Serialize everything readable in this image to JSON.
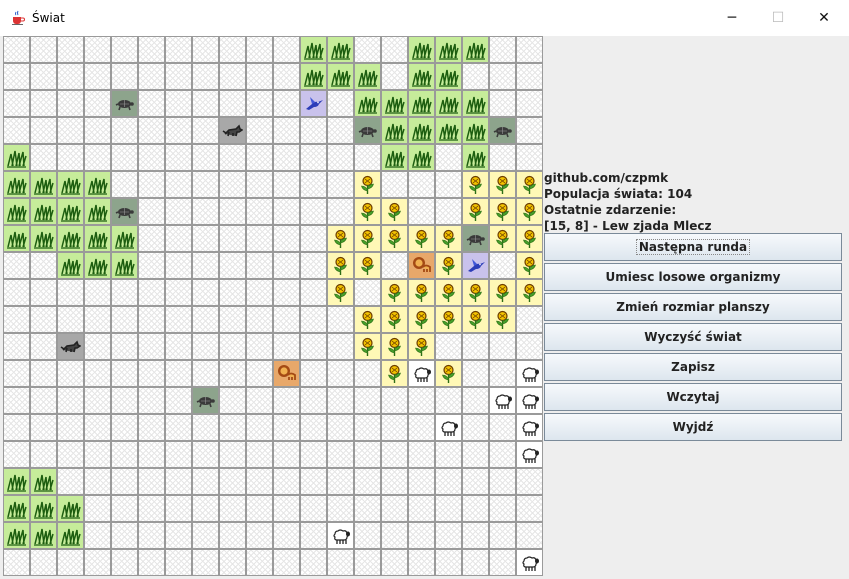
{
  "window": {
    "title": "Świat",
    "app_icon": "java-cup-icon",
    "controls": {
      "minimize": "─",
      "maximize": "☐",
      "close": "✕"
    }
  },
  "board": {
    "cols": 20,
    "rows": 20,
    "organisms": [
      {
        "x": 11,
        "y": 0,
        "type": "grass"
      },
      {
        "x": 12,
        "y": 0,
        "type": "grass"
      },
      {
        "x": 15,
        "y": 0,
        "type": "grass"
      },
      {
        "x": 16,
        "y": 0,
        "type": "grass"
      },
      {
        "x": 17,
        "y": 0,
        "type": "grass"
      },
      {
        "x": 11,
        "y": 1,
        "type": "grass"
      },
      {
        "x": 12,
        "y": 1,
        "type": "grass"
      },
      {
        "x": 13,
        "y": 1,
        "type": "grass"
      },
      {
        "x": 15,
        "y": 1,
        "type": "grass"
      },
      {
        "x": 16,
        "y": 1,
        "type": "grass"
      },
      {
        "x": 4,
        "y": 2,
        "type": "turtle"
      },
      {
        "x": 11,
        "y": 2,
        "type": "hummingbird"
      },
      {
        "x": 13,
        "y": 2,
        "type": "grass"
      },
      {
        "x": 14,
        "y": 2,
        "type": "grass"
      },
      {
        "x": 15,
        "y": 2,
        "type": "grass"
      },
      {
        "x": 16,
        "y": 2,
        "type": "grass"
      },
      {
        "x": 17,
        "y": 2,
        "type": "grass"
      },
      {
        "x": 8,
        "y": 3,
        "type": "wolf"
      },
      {
        "x": 13,
        "y": 3,
        "type": "turtle"
      },
      {
        "x": 14,
        "y": 3,
        "type": "grass"
      },
      {
        "x": 15,
        "y": 3,
        "type": "grass"
      },
      {
        "x": 16,
        "y": 3,
        "type": "grass"
      },
      {
        "x": 17,
        "y": 3,
        "type": "grass"
      },
      {
        "x": 18,
        "y": 3,
        "type": "turtle"
      },
      {
        "x": 0,
        "y": 4,
        "type": "grass"
      },
      {
        "x": 14,
        "y": 4,
        "type": "grass"
      },
      {
        "x": 15,
        "y": 4,
        "type": "grass"
      },
      {
        "x": 17,
        "y": 4,
        "type": "grass"
      },
      {
        "x": 0,
        "y": 5,
        "type": "grass"
      },
      {
        "x": 1,
        "y": 5,
        "type": "grass"
      },
      {
        "x": 2,
        "y": 5,
        "type": "grass"
      },
      {
        "x": 3,
        "y": 5,
        "type": "grass"
      },
      {
        "x": 13,
        "y": 5,
        "type": "dandelion"
      },
      {
        "x": 17,
        "y": 5,
        "type": "dandelion"
      },
      {
        "x": 18,
        "y": 5,
        "type": "dandelion"
      },
      {
        "x": 19,
        "y": 5,
        "type": "dandelion"
      },
      {
        "x": 0,
        "y": 6,
        "type": "grass"
      },
      {
        "x": 1,
        "y": 6,
        "type": "grass"
      },
      {
        "x": 2,
        "y": 6,
        "type": "grass"
      },
      {
        "x": 3,
        "y": 6,
        "type": "grass"
      },
      {
        "x": 4,
        "y": 6,
        "type": "turtle"
      },
      {
        "x": 13,
        "y": 6,
        "type": "dandelion"
      },
      {
        "x": 14,
        "y": 6,
        "type": "dandelion"
      },
      {
        "x": 17,
        "y": 6,
        "type": "dandelion"
      },
      {
        "x": 18,
        "y": 6,
        "type": "dandelion"
      },
      {
        "x": 19,
        "y": 6,
        "type": "dandelion"
      },
      {
        "x": 0,
        "y": 7,
        "type": "grass"
      },
      {
        "x": 1,
        "y": 7,
        "type": "grass"
      },
      {
        "x": 2,
        "y": 7,
        "type": "grass"
      },
      {
        "x": 3,
        "y": 7,
        "type": "grass"
      },
      {
        "x": 4,
        "y": 7,
        "type": "grass"
      },
      {
        "x": 12,
        "y": 7,
        "type": "dandelion"
      },
      {
        "x": 13,
        "y": 7,
        "type": "dandelion"
      },
      {
        "x": 14,
        "y": 7,
        "type": "dandelion"
      },
      {
        "x": 15,
        "y": 7,
        "type": "dandelion"
      },
      {
        "x": 16,
        "y": 7,
        "type": "dandelion"
      },
      {
        "x": 17,
        "y": 7,
        "type": "turtle"
      },
      {
        "x": 18,
        "y": 7,
        "type": "dandelion"
      },
      {
        "x": 19,
        "y": 7,
        "type": "dandelion"
      },
      {
        "x": 2,
        "y": 8,
        "type": "grass"
      },
      {
        "x": 3,
        "y": 8,
        "type": "grass"
      },
      {
        "x": 4,
        "y": 8,
        "type": "grass"
      },
      {
        "x": 12,
        "y": 8,
        "type": "dandelion"
      },
      {
        "x": 13,
        "y": 8,
        "type": "dandelion"
      },
      {
        "x": 15,
        "y": 8,
        "type": "lion"
      },
      {
        "x": 16,
        "y": 8,
        "type": "dandelion"
      },
      {
        "x": 17,
        "y": 8,
        "type": "hummingbird"
      },
      {
        "x": 19,
        "y": 8,
        "type": "dandelion"
      },
      {
        "x": 12,
        "y": 9,
        "type": "dandelion"
      },
      {
        "x": 14,
        "y": 9,
        "type": "dandelion"
      },
      {
        "x": 15,
        "y": 9,
        "type": "dandelion"
      },
      {
        "x": 16,
        "y": 9,
        "type": "dandelion"
      },
      {
        "x": 17,
        "y": 9,
        "type": "dandelion"
      },
      {
        "x": 18,
        "y": 9,
        "type": "dandelion"
      },
      {
        "x": 19,
        "y": 9,
        "type": "dandelion"
      },
      {
        "x": 13,
        "y": 10,
        "type": "dandelion"
      },
      {
        "x": 14,
        "y": 10,
        "type": "dandelion"
      },
      {
        "x": 15,
        "y": 10,
        "type": "dandelion"
      },
      {
        "x": 16,
        "y": 10,
        "type": "dandelion"
      },
      {
        "x": 17,
        "y": 10,
        "type": "dandelion"
      },
      {
        "x": 18,
        "y": 10,
        "type": "dandelion"
      },
      {
        "x": 2,
        "y": 11,
        "type": "wolf"
      },
      {
        "x": 13,
        "y": 11,
        "type": "dandelion"
      },
      {
        "x": 14,
        "y": 11,
        "type": "dandelion"
      },
      {
        "x": 15,
        "y": 11,
        "type": "dandelion"
      },
      {
        "x": 10,
        "y": 12,
        "type": "lion"
      },
      {
        "x": 14,
        "y": 12,
        "type": "dandelion"
      },
      {
        "x": 15,
        "y": 12,
        "type": "sheep"
      },
      {
        "x": 16,
        "y": 12,
        "type": "dandelion"
      },
      {
        "x": 19,
        "y": 12,
        "type": "sheep"
      },
      {
        "x": 7,
        "y": 13,
        "type": "turtle"
      },
      {
        "x": 18,
        "y": 13,
        "type": "sheep"
      },
      {
        "x": 19,
        "y": 13,
        "type": "sheep"
      },
      {
        "x": 16,
        "y": 14,
        "type": "sheep"
      },
      {
        "x": 19,
        "y": 14,
        "type": "sheep"
      },
      {
        "x": 19,
        "y": 15,
        "type": "sheep"
      },
      {
        "x": 0,
        "y": 16,
        "type": "grass"
      },
      {
        "x": 1,
        "y": 16,
        "type": "grass"
      },
      {
        "x": 0,
        "y": 17,
        "type": "grass"
      },
      {
        "x": 1,
        "y": 17,
        "type": "grass"
      },
      {
        "x": 2,
        "y": 17,
        "type": "grass"
      },
      {
        "x": 0,
        "y": 18,
        "type": "grass"
      },
      {
        "x": 1,
        "y": 18,
        "type": "grass"
      },
      {
        "x": 2,
        "y": 18,
        "type": "grass"
      },
      {
        "x": 12,
        "y": 18,
        "type": "sheep"
      },
      {
        "x": 19,
        "y": 19,
        "type": "sheep"
      }
    ]
  },
  "info": {
    "repo": "github.com/czpmk",
    "population": "Populacja świata: 104",
    "last_event_label": "Ostatnie zdarzenie:",
    "last_event": "[15, 8] - Lew zjada Mlecz"
  },
  "buttons": {
    "next_round": "Następna runda",
    "random_organisms": "Umiesc losowe organizmy",
    "resize_board": "Zmień rozmiar planszy",
    "clear_world": "Wyczyść świat",
    "save": "Zapisz",
    "load": "Wczytaj",
    "exit": "Wyjdź"
  }
}
